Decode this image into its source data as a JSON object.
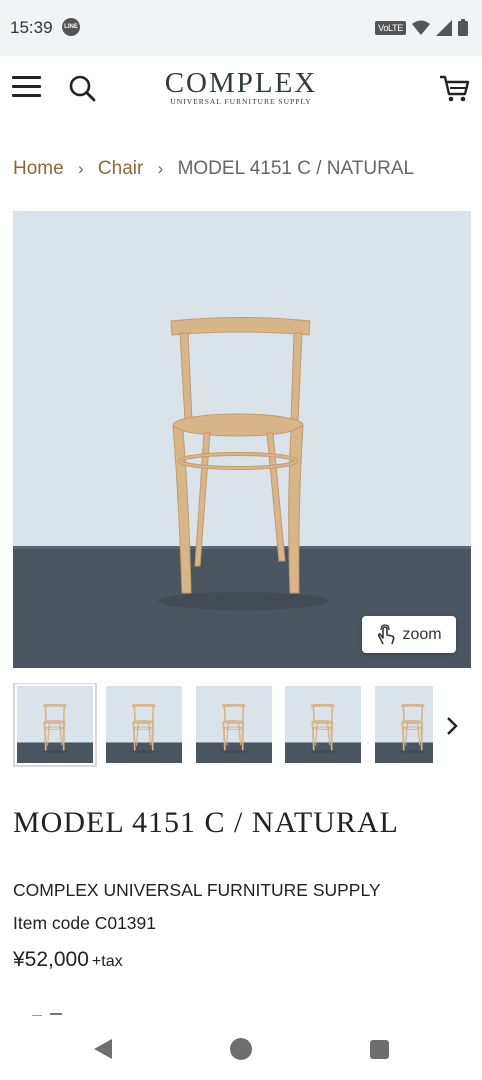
{
  "status_bar": {
    "time": "15:39",
    "line_badge": "LINE",
    "network": "VoLTE"
  },
  "header": {
    "logo_main": "COMPLEX",
    "logo_sub": "UNIVERSAL FURNITURE SUPPLY",
    "icons": [
      "menu-icon",
      "search-icon",
      "cart-icon"
    ]
  },
  "breadcrumb": {
    "home": "Home",
    "category": "Chair",
    "current": "MODEL 4151 C / NATURAL"
  },
  "gallery": {
    "zoom_label": "zoom",
    "thumbnail_count": 5
  },
  "product": {
    "title": "MODEL 4151 C / NATURAL",
    "brand": "COMPLEX UNIVERSAL FURNITURE SUPPLY",
    "item_code": "Item code C01391",
    "price": "¥52,000",
    "tax_label": "+tax"
  },
  "colors": {
    "accent_link": "#8a6a32",
    "logo": "#2f3e36",
    "wall": "#d9e2ea",
    "floor": "#4a5560",
    "wood": "#d9b58a"
  }
}
